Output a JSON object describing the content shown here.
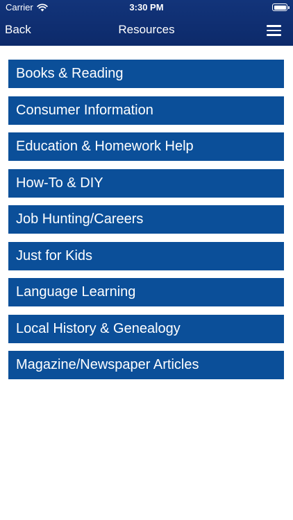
{
  "status_bar": {
    "carrier": "Carrier",
    "time": "3:30 PM",
    "wifi_icon": "wifi-icon",
    "battery_icon": "battery-icon"
  },
  "nav": {
    "back_label": "Back",
    "title": "Resources",
    "menu_icon": "hamburger-menu-icon"
  },
  "colors": {
    "nav_background": "#12347a",
    "item_background": "#0b4f99",
    "text": "#ffffff",
    "page_background": "#ffffff"
  },
  "resources": [
    {
      "label": "Books & Reading"
    },
    {
      "label": "Consumer Information"
    },
    {
      "label": "Education & Homework Help"
    },
    {
      "label": "How-To & DIY"
    },
    {
      "label": "Job Hunting/Careers"
    },
    {
      "label": "Just for Kids"
    },
    {
      "label": "Language Learning"
    },
    {
      "label": "Local History & Genealogy"
    },
    {
      "label": "Magazine/Newspaper Articles"
    }
  ]
}
